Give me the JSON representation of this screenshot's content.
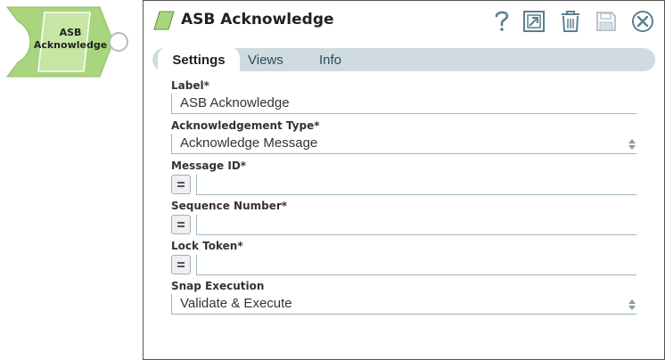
{
  "canvas": {
    "snap_label": "ASB Acknowledge"
  },
  "dialog": {
    "title": "ASB Acknowledge",
    "toolbar": {
      "help": "help-icon",
      "export": "export-icon",
      "delete": "trash-icon",
      "save": "save-icon",
      "close": "close-icon"
    },
    "tabs": [
      {
        "label": "Settings",
        "active": true
      },
      {
        "label": "Views",
        "active": false
      },
      {
        "label": "Info",
        "active": false
      }
    ],
    "fields": {
      "label": {
        "label": "Label*",
        "value": "ASB Acknowledge"
      },
      "ack_type": {
        "label": "Acknowledgement Type*",
        "value": "Acknowledge Message"
      },
      "message_id": {
        "label": "Message ID*",
        "value": ""
      },
      "sequence_number": {
        "label": "Sequence Number*",
        "value": ""
      },
      "lock_token": {
        "label": "Lock Token*",
        "value": ""
      },
      "snap_execution": {
        "label": "Snap Execution",
        "value": "Validate & Execute"
      }
    }
  },
  "colors": {
    "snap_green": "#a8d57e",
    "snap_border": "#7bb04e",
    "tab_bar": "#cfdbe0",
    "field_line": "#9eb6c2",
    "icon_blue": "#5b7f8f"
  }
}
